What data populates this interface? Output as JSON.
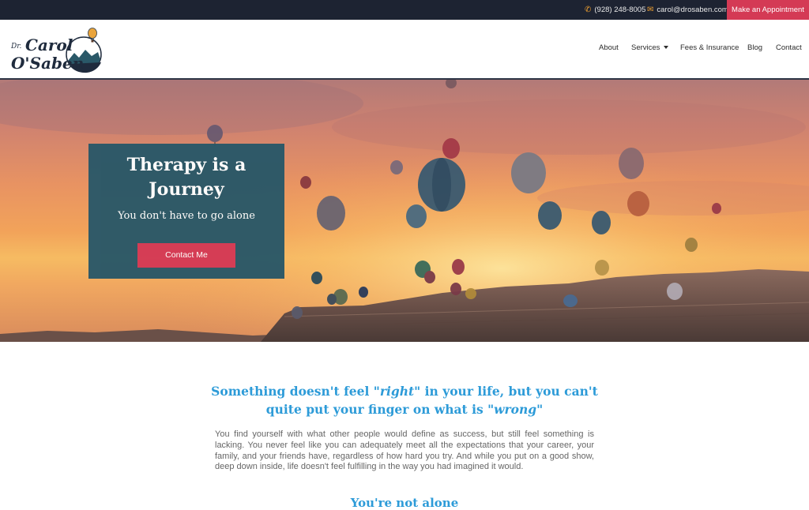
{
  "topbar": {
    "phone_icon": "phone-icon",
    "phone": "(928) 248-8005",
    "email_icon": "envelope-icon",
    "email": "carol@drosaben.com",
    "appointment_label": "Make an Appointment"
  },
  "logo": {
    "line1": "Dr.",
    "line2": "Carol",
    "line3": "O'Saben"
  },
  "nav": {
    "items": [
      {
        "label": "About"
      },
      {
        "label": "Services"
      },
      {
        "label": "Fees & Insurance"
      },
      {
        "label": "Blog"
      },
      {
        "label": "Contact"
      }
    ]
  },
  "hero": {
    "title": "Therapy is a Journey",
    "subtitle": "You don't have to go alone",
    "button_label": "Contact Me"
  },
  "content": {
    "headline_a": "Something doesn't feel ",
    "headline_b": "\"right\"",
    "headline_c": " in your life, but you can't quite put your finger on what is ",
    "headline_d": "\"wrong\"",
    "body": "You find yourself with what other people would define as success, but still feel something is lacking. You never feel like you can adequately meet all the expectations that your career, your family, and your friends have, regardless of how hard you try. And while you put on a good show, deep down inside, life doesn't feel fulfilling in the way you had imagined it would.",
    "subhead": "You're not alone"
  },
  "colors": {
    "topbar_bg": "#1d2332",
    "accent": "#d43a55",
    "card_bg": "#2a5868",
    "heading_blue": "#2d9bd8"
  }
}
